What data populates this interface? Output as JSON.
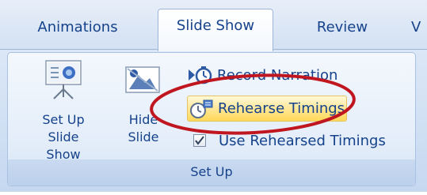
{
  "tabs": [
    {
      "label": "Animations"
    },
    {
      "label": "Slide Show"
    },
    {
      "label": "Review"
    },
    {
      "label": "V"
    }
  ],
  "group": {
    "label": "Set Up",
    "setup_slideshow": {
      "line1": "Set Up",
      "line2": "Slide Show"
    },
    "hide_slide": {
      "line1": "Hide",
      "line2": "Slide"
    },
    "record_narration": "Record Narration",
    "rehearse_timings": "Rehearse Timings",
    "use_rehearsed_timings": {
      "label": "Use Rehearsed Timings",
      "checked": true
    }
  },
  "colors": {
    "accent_text": "#15428b",
    "highlight": "#ffe798",
    "annotation": "#c0161f"
  },
  "icons": [
    "setup-slideshow-icon",
    "hide-slide-icon",
    "record-narration-icon",
    "rehearse-timings-icon",
    "checkbox-checked-icon"
  ]
}
